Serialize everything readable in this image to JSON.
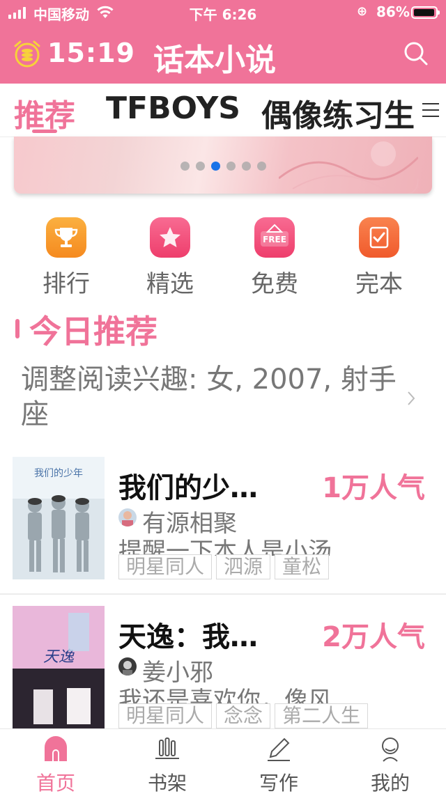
{
  "status_bar": {
    "carrier": "中国移动",
    "time": "下午 6:26",
    "battery": "86%"
  },
  "header": {
    "timer": "15:19",
    "title": "话本小说"
  },
  "tabs": [
    {
      "label": "推荐",
      "active": true
    },
    {
      "label": "TFBOYS",
      "active": false
    },
    {
      "label": "偶像练习生",
      "active": false
    }
  ],
  "banner": {
    "dot_count": 6,
    "active_index": 2
  },
  "quick_entries": [
    {
      "label": "排行",
      "icon": "trophy-icon",
      "color": "#f8962b"
    },
    {
      "label": "精选",
      "icon": "star-icon",
      "color": "#f2517d"
    },
    {
      "label": "免费",
      "icon": "free-tag-icon",
      "color": "#f2517d",
      "icon_text": "FREE"
    },
    {
      "label": "完本",
      "icon": "check-book-icon",
      "color": "#f26a3a"
    }
  ],
  "section": {
    "title": "今日推荐"
  },
  "interest": {
    "text": "调整阅读兴趣: 女, 2007, 射手座"
  },
  "books": [
    {
      "title": "我们的少…",
      "popularity": "1万人气",
      "author": "有源相聚",
      "desc": "提醒一下本人是小汤",
      "tags": [
        "明星同人",
        "泗源",
        "童松"
      ],
      "cover_text": "我们的少年"
    },
    {
      "title": "天逸：我…",
      "popularity": "2万人气",
      "author": "姜小邪",
      "desc": "我还是喜欢你，像风",
      "tags": [
        "明星同人",
        "念念",
        "第二人生"
      ],
      "cover_text": "天逸"
    }
  ],
  "bottom_nav": [
    {
      "label": "首页",
      "icon": "home-icon",
      "active": true
    },
    {
      "label": "书架",
      "icon": "bookshelf-icon",
      "active": false
    },
    {
      "label": "写作",
      "icon": "pen-icon",
      "active": false
    },
    {
      "label": "我的",
      "icon": "profile-icon",
      "active": false
    }
  ],
  "colors": {
    "brand": "#f07399",
    "dot_active": "#1a73e8"
  }
}
